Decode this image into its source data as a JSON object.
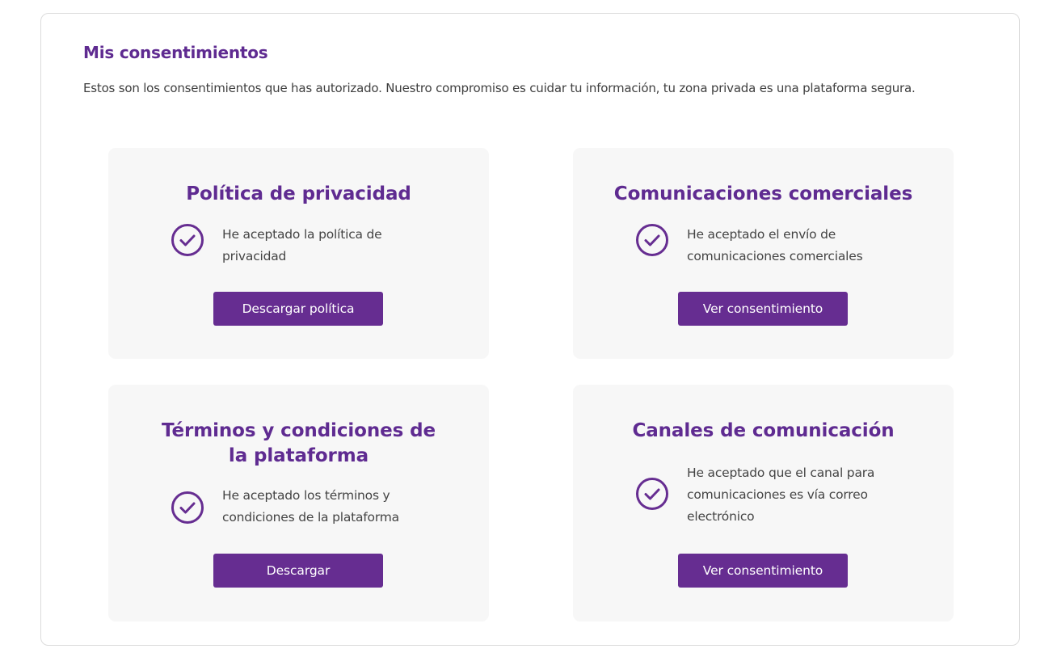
{
  "section": {
    "title": "Mis consentimientos",
    "description": "Estos son los consentimientos que has autorizado. Nuestro compromiso es cuidar tu información, tu zona privada es una plataforma segura."
  },
  "cards": [
    {
      "title": "Política de privacidad",
      "text": "He aceptado la política de privacidad",
      "button": "Descargar política",
      "icon": "check-circle-icon"
    },
    {
      "title": "Comunicaciones comerciales",
      "text": "He aceptado el envío de comunicaciones comerciales",
      "button": "Ver consentimiento",
      "icon": "check-circle-icon"
    },
    {
      "title": "Términos y condiciones de la plataforma",
      "text": "He aceptado los términos y condiciones de la plataforma",
      "button": "Descargar",
      "icon": "check-circle-icon"
    },
    {
      "title": "Canales de comunicación",
      "text": "He aceptado que el canal para comunicaciones es vía correo electrónico",
      "button": "Ver consentimiento",
      "icon": "check-circle-icon"
    }
  ],
  "colors": {
    "brand_purple": "#662d91",
    "title_purple": "#5f2b91",
    "card_background": "#f7f7f7",
    "border": "#dcdcdc"
  }
}
